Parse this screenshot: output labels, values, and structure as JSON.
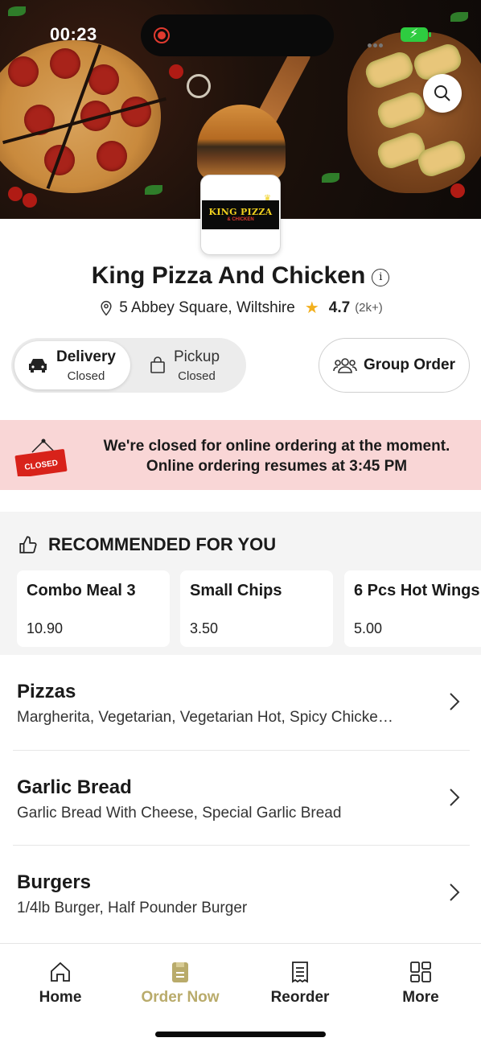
{
  "status_bar": {
    "time": "00:23"
  },
  "store": {
    "logo": {
      "name": "KING PIZZA",
      "sub": "& CHICKEN"
    },
    "name": "King Pizza And Chicken",
    "address": "5 Abbey Square, Wiltshire",
    "rating": "4.7",
    "rating_count": "(2k+)"
  },
  "modes": {
    "delivery": {
      "label": "Delivery",
      "status": "Closed"
    },
    "pickup": {
      "label": "Pickup",
      "status": "Closed"
    },
    "group_order": "Group Order"
  },
  "closed_banner": {
    "sign": "CLOSED",
    "line1": "We're closed for online ordering at the moment.",
    "line2": "Online ordering resumes at 3:45 PM"
  },
  "recommended": {
    "title": "RECOMMENDED FOR YOU",
    "items": [
      {
        "name": "Combo Meal 3",
        "price": "10.90"
      },
      {
        "name": "Small Chips",
        "price": "3.50"
      },
      {
        "name": "6 Pcs Hot Wings",
        "price": "5.00"
      }
    ]
  },
  "categories": [
    {
      "title": "Pizzas",
      "desc": "Margherita, Vegetarian, Vegetarian Hot, Spicy Chicke…"
    },
    {
      "title": "Garlic Bread",
      "desc": "Garlic Bread With Cheese, Special Garlic Bread"
    },
    {
      "title": "Burgers",
      "desc": "1/4lb Burger, Half Pounder Burger"
    }
  ],
  "bottom_nav": [
    {
      "label": "Home",
      "icon": "home-icon"
    },
    {
      "label": "Order Now",
      "icon": "order-icon",
      "active": true
    },
    {
      "label": "Reorder",
      "icon": "receipt-icon"
    },
    {
      "label": "More",
      "icon": "grid-icon"
    }
  ],
  "colors": {
    "accent": "#b9ab6b",
    "closed_banner_bg": "#f9d6d6",
    "star": "#f2b01e"
  }
}
